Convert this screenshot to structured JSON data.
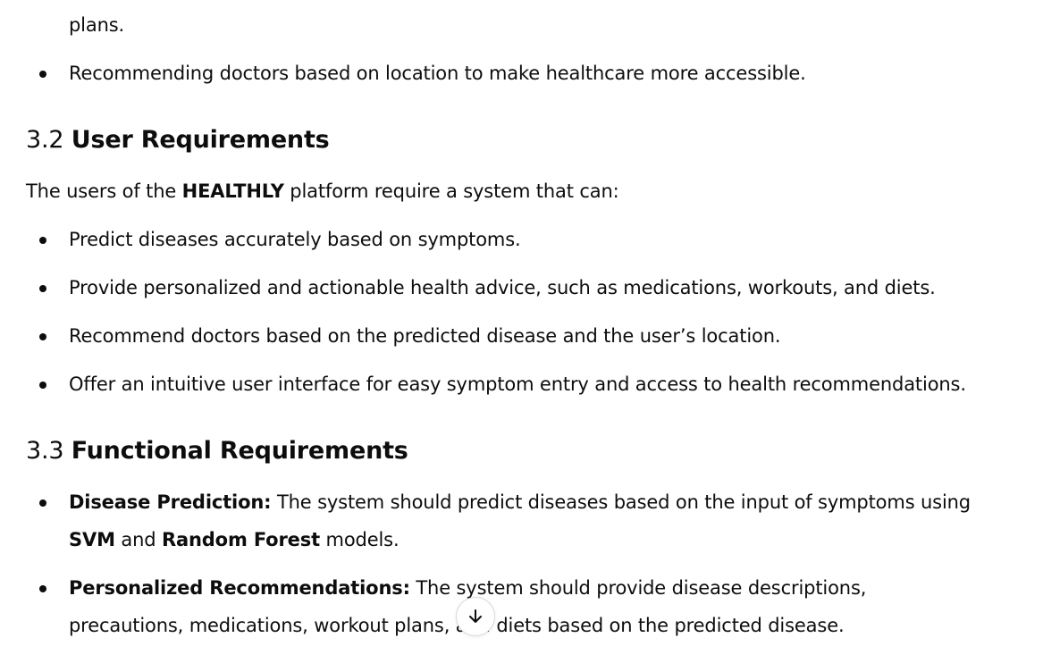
{
  "continuation": {
    "text": "plans."
  },
  "objectives_tail": [
    "Recommending doctors based on location to make healthcare more accessible."
  ],
  "section_3_2": {
    "number": "3.2",
    "title": "User Requirements",
    "intro_before": "The users of the ",
    "intro_bold": "HEALTHLY",
    "intro_after": " platform require a system that can:",
    "items": [
      "Predict diseases accurately based on symptoms.",
      "Provide personalized and actionable health advice, such as medications, workouts, and diets.",
      "Recommend doctors based on the predicted disease and the user’s location.",
      "Offer an intuitive user interface for easy symptom entry and access to health recommendations."
    ]
  },
  "section_3_3": {
    "number": "3.3",
    "title": "Functional Requirements",
    "items": [
      {
        "label": "Disease Prediction:",
        "text_1": " The system should predict diseases based on the input of symptoms using ",
        "bold_1": "SVM",
        "text_2": " and ",
        "bold_2": "Random Forest",
        "text_3": " models."
      },
      {
        "label": "Personalized Recommendations:",
        "text_1": " The system should provide disease descriptions, precautions, medications, workout plans, and diets based on the predicted disease."
      }
    ]
  },
  "scroll_button": {
    "icon": "arrow-down-icon"
  }
}
